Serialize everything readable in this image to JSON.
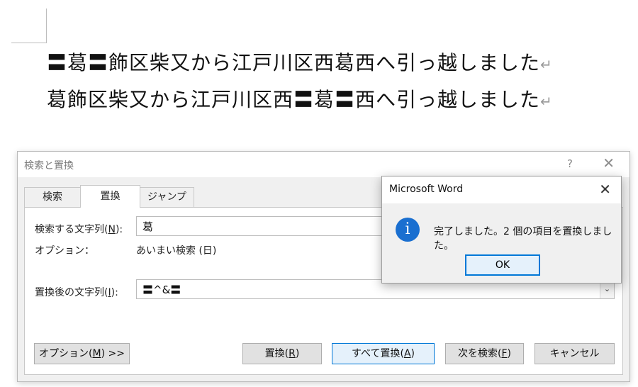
{
  "document": {
    "line1": "〓葛〓飾区柴又から江戸川区西葛西へ引っ越しました",
    "line2": "葛飾区柴又から江戸川区西〓葛〓西へ引っ越しました",
    "paragraph_mark": "↵"
  },
  "find_replace_dialog": {
    "title": "検索と置換",
    "help": "?",
    "close": "✕",
    "tabs": [
      {
        "label": "検索"
      },
      {
        "label": "置換",
        "active": true
      },
      {
        "label": "ジャンプ"
      }
    ],
    "find_label_pre": "検索する文字列(",
    "find_label_key": "N",
    "find_label_post": "):",
    "find_value": "葛",
    "options_label": "オプション：",
    "options_value": "あいまい検索 (日)",
    "replace_label_pre": "置換後の文字列(",
    "replace_label_key": "I",
    "replace_label_post": "):",
    "replace_value": "〓^&〓",
    "combo_arrow": "⌄",
    "buttons": {
      "options_pre": "オプション(",
      "options_key": "M",
      "options_post": ") >>",
      "replace_pre": "置換(",
      "replace_key": "R",
      "replace_post": ")",
      "replace_all_pre": "すべて置換(",
      "replace_all_key": "A",
      "replace_all_post": ")",
      "find_next_pre": "次を検索(",
      "find_next_key": "F",
      "find_next_post": ")",
      "cancel": "キャンセル"
    }
  },
  "message_box": {
    "title": "Microsoft Word",
    "close": "✕",
    "icon": "information-icon",
    "icon_glyph": "i",
    "text": "完了しました。2 個の項目を置換しました。",
    "ok_label": "OK"
  },
  "colors": {
    "accent": "#0078d7",
    "info_icon": "#1a6fd0",
    "dialog_bg": "#f0f0f0"
  }
}
